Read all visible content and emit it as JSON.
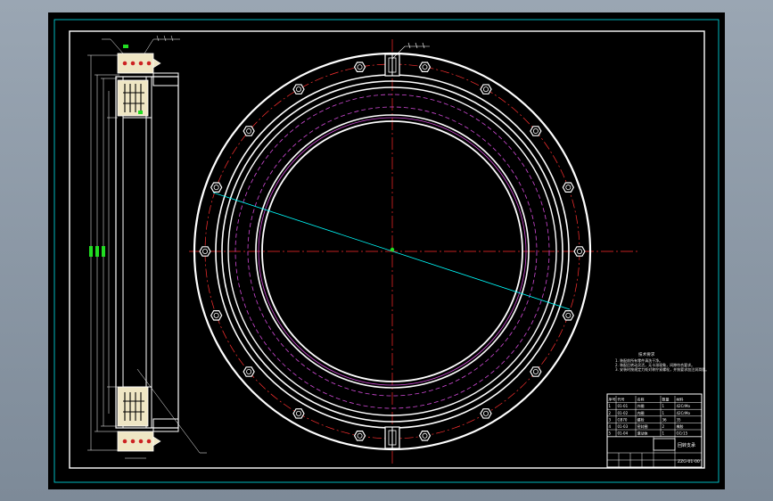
{
  "colors": {
    "background": "#000000",
    "outline": "#ffffff",
    "frame_cyan": "#00e5ee",
    "centerline": "#ff2a2a",
    "bolt_circle": "#ff3030",
    "hidden_magenta": "#d24ad8",
    "section_fill": "#efe6c4",
    "dimension_green": "#22dd22",
    "leader_cyan": "#00ffff"
  },
  "drawing": {
    "bolt_hole_count": 18
  },
  "notes": {
    "heading": "技术要求",
    "lines": [
      "1. 装配前所有零件清洗干净。",
      "2. 装配后转动灵活，无卡滞现象，间隙符合要求。",
      "3. 安装时按规定力矩对称拧紧螺栓，并按要求加注润滑脂。"
    ]
  },
  "title_block": {
    "drawing_name": "回转支承",
    "drawing_code": "ZZG-01-00",
    "rows": [
      [
        "序号",
        "代号",
        "名称",
        "数量",
        "材料"
      ],
      [
        "1",
        "01-01",
        "外圈",
        "1",
        "42CrMo"
      ],
      [
        "2",
        "01-02",
        "内圈",
        "1",
        "42CrMo"
      ],
      [
        "3",
        "GB70",
        "螺栓",
        "36",
        "35"
      ],
      [
        "4",
        "01-03",
        "密封圈",
        "2",
        "橡胶"
      ],
      [
        "5",
        "01-04",
        "滚动体",
        "1",
        "GCr15"
      ]
    ]
  }
}
